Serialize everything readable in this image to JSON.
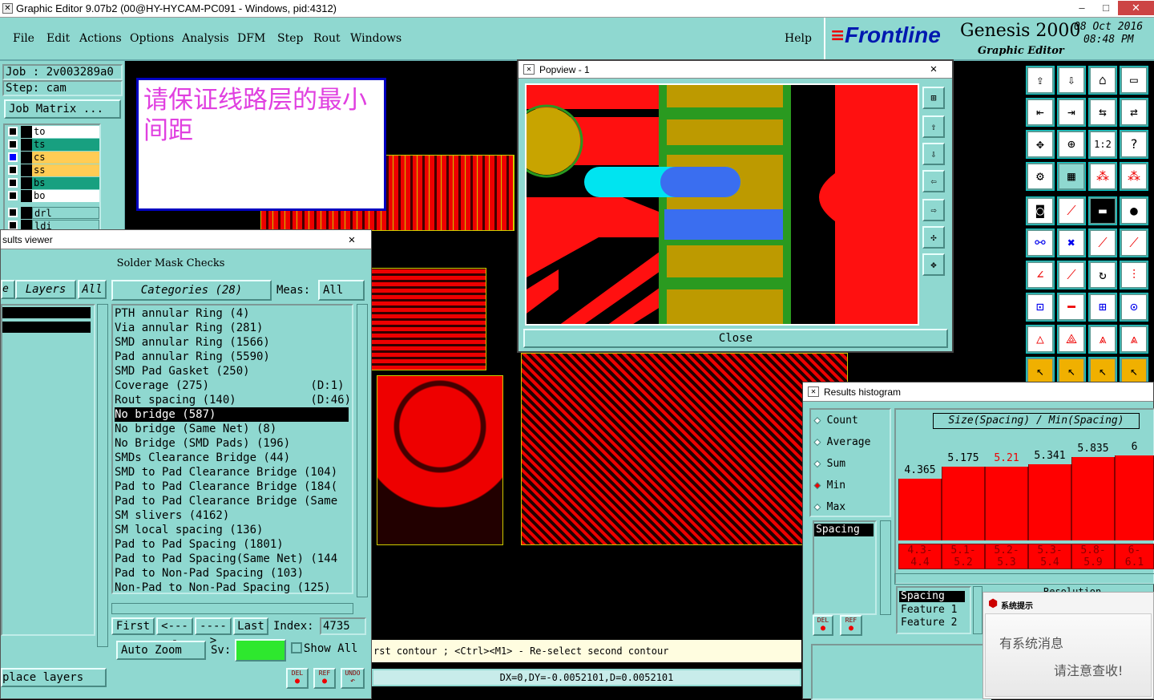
{
  "window": {
    "title": "Graphic Editor 9.07b2 (00@HY-HYCAM-PC091 - Windows, pid:4312)",
    "minimize": "–",
    "maximize": "□",
    "close": "✕"
  },
  "menu": [
    "File",
    "Edit",
    "Actions",
    "Options",
    "Analysis",
    "DFM",
    "Step",
    "Rout",
    "Windows"
  ],
  "help": "Help",
  "brand": {
    "logo": "Frontline",
    "product": "Genesis 2000",
    "subtitle": "Graphic Editor",
    "date": "08 Oct 2016",
    "time": "08:48 PM"
  },
  "job": {
    "job_label": "Job : 2v003289a0",
    "step_label": "Step: cam",
    "matrix_button": "Job Matrix ..."
  },
  "layers": [
    {
      "name": "to",
      "color": "#ffffff",
      "mark": "◆"
    },
    {
      "name": "ts",
      "color": "#18a080",
      "mark": "◆"
    },
    {
      "name": "cs",
      "color": "#ffcc55",
      "mark": "■"
    },
    {
      "name": "ss",
      "color": "#ffcc55",
      "mark": ""
    },
    {
      "name": "bs",
      "color": "#18a080",
      "mark": "◆"
    },
    {
      "name": "bo",
      "color": "#ffffff",
      "mark": ""
    },
    {
      "name": "drl",
      "color": "#8fd8d0",
      "mark": ""
    },
    {
      "name": "ldi",
      "color": "#8fd8d0",
      "mark": ""
    }
  ],
  "message": "请保证线路层的最小间距",
  "results_viewer": {
    "title": "sults viewer",
    "section": "Solder Mask Checks",
    "layers_label": "Layers",
    "all_label": "All",
    "categories_label": "Categories (28)",
    "meas_label": "Meas:",
    "meas_value": "All",
    "categories": [
      "PTH annular Ring (4)",
      "Via annular Ring (281)",
      "SMD annular Ring (1566)",
      "Pad annular Ring (5590)",
      "SMD Pad Gasket (250)",
      "Coverage (275)               (D:1)",
      "Rout spacing (140)           (D:46)",
      "No bridge (587)",
      "No bridge (Same Net) (8)",
      "No Bridge (SMD Pads) (196)",
      "SMDs Clearance Bridge (44)",
      "SMD to Pad Clearance Bridge (104)",
      "Pad to Pad Clearance Bridge (184(",
      "Pad to Pad Clearance Bridge (Same",
      "SM slivers (4162)",
      "SM local spacing (136)",
      "Pad to Pad Spacing (1801)",
      "Pad to Pad Spacing(Same Net) (144",
      "Pad to Non-Pad Spacing (103)",
      "Non-Pad to Non-Pad Spacing (125)"
    ],
    "selected_index": 7,
    "nav": {
      "first": "First",
      "prev": "<----",
      "next": "---->",
      "last": "Last",
      "index_label": "Index:",
      "index_value": "4735"
    },
    "auto_zoom": "Auto Zoom",
    "sv_label": "Sv:",
    "show_all": "Show All",
    "place_layers": "place layers",
    "del": "DEL",
    "ref": "REF",
    "undo": "UNDO"
  },
  "popview": {
    "title": "Popview - 1",
    "close": "Close"
  },
  "histogram": {
    "title": "Results histogram",
    "options": [
      "Count",
      "Average",
      "Sum",
      "Min",
      "Max"
    ],
    "selected_option": "Min",
    "list_item": "Spacing",
    "header": "Size(Spacing) / Min(Spacing)",
    "bars": [
      {
        "value": "4.365",
        "range_top": "4.3-",
        "range_bottom": "4.4",
        "level": 0.55
      },
      {
        "value": "5.175",
        "range_top": "5.1-",
        "range_bottom": "5.2",
        "level": 0.66
      },
      {
        "value": "5.21",
        "range_top": "5.2-",
        "range_bottom": "5.3",
        "level": 0.66
      },
      {
        "value": "5.341",
        "range_top": "5.3-",
        "range_bottom": "5.4",
        "level": 0.68
      },
      {
        "value": "5.835",
        "range_top": "5.8-",
        "range_bottom": "5.9",
        "level": 0.74
      },
      {
        "value": "6",
        "range_top": "6-",
        "range_bottom": "6.1",
        "level": 0.76
      }
    ],
    "bottom_list": [
      "Spacing",
      "Feature 1",
      "Feature 2"
    ],
    "resolution": "Resolution",
    "del": "DEL",
    "ref": "REF"
  },
  "status": {
    "hint": "rst contour ; <Ctrl><M1> - Re-select second contour",
    "coords": "DX=0,DY=-0.0052101,D=0.0052101"
  },
  "system_message": {
    "title": "系统提示",
    "line1": "有系统消息",
    "line2": "请注意查收!"
  }
}
